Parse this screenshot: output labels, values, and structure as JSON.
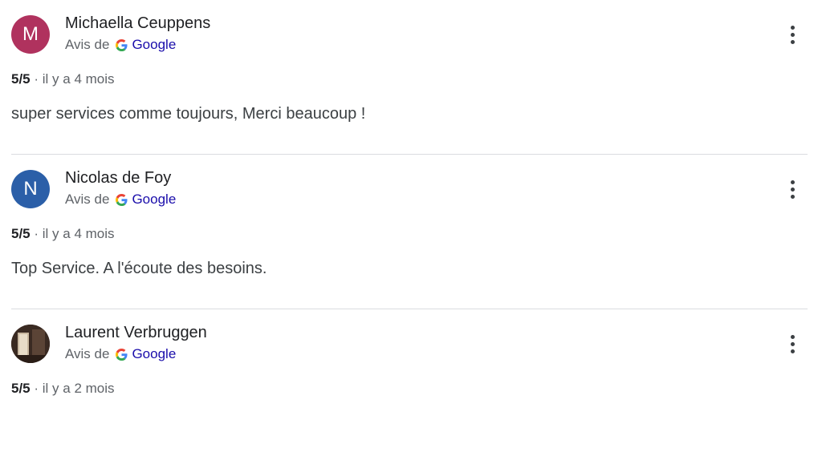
{
  "reviews": [
    {
      "initial": "M",
      "avatar_color": "#b0325e",
      "author": "Michaella Ceuppens",
      "source_prefix": "Avis de",
      "source_brand": "Google",
      "rating": "5/5",
      "separator": "·",
      "time": "il y a 4 mois",
      "text": "super services comme toujours, Merci beaucoup !"
    },
    {
      "initial": "N",
      "avatar_color": "#2b5fa8",
      "author": "Nicolas de Foy",
      "source_prefix": "Avis de",
      "source_brand": "Google",
      "rating": "5/5",
      "separator": "·",
      "time": "il y a 4 mois",
      "text": "Top Service. A l'écoute des besoins."
    },
    {
      "initial": "",
      "avatar_color": "#3a2a22",
      "author": "Laurent Verbruggen",
      "source_prefix": "Avis de",
      "source_brand": "Google",
      "rating": "5/5",
      "separator": "·",
      "time": "il y a 2 mois",
      "text": ""
    }
  ]
}
